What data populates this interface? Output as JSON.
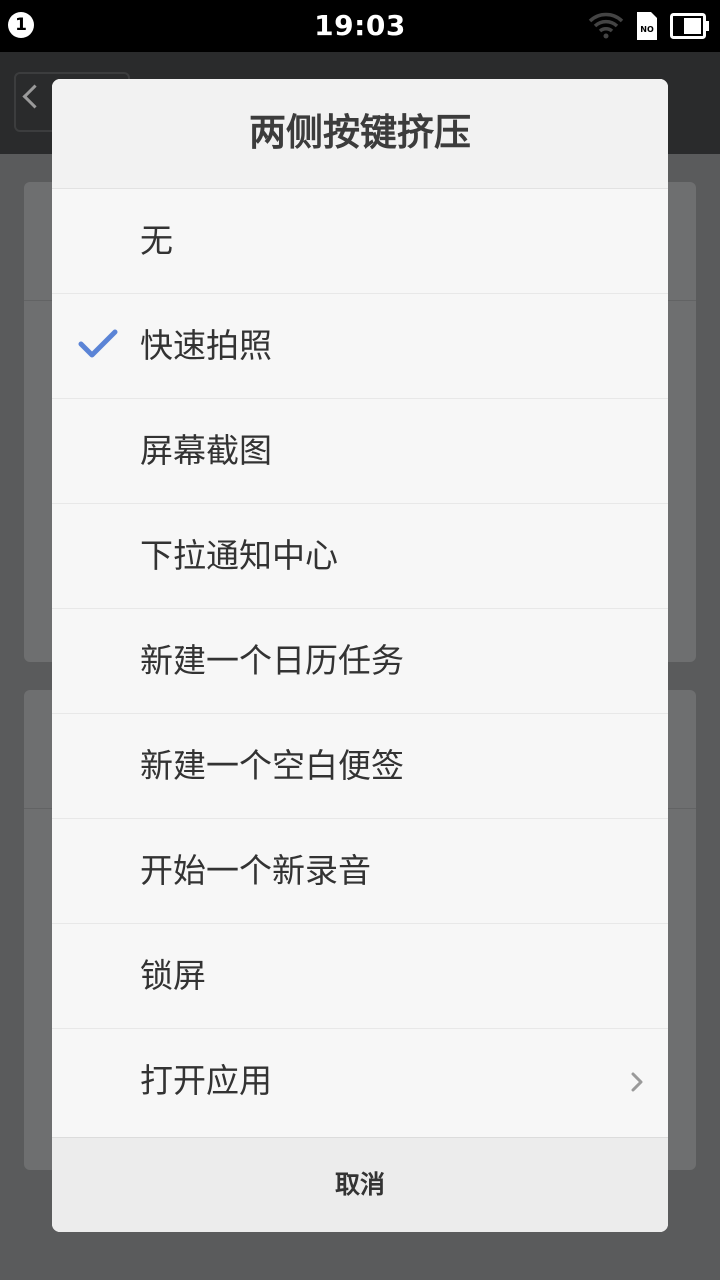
{
  "status_bar": {
    "notification_count": "1",
    "time": "19:03",
    "sim_label": "NO"
  },
  "dialog": {
    "title": "两侧按键挤压",
    "selected_index": 1,
    "options": [
      {
        "label": "无"
      },
      {
        "label": "快速拍照"
      },
      {
        "label": "屏幕截图"
      },
      {
        "label": "下拉通知中心"
      },
      {
        "label": "新建一个日历任务"
      },
      {
        "label": "新建一个空白便签"
      },
      {
        "label": "开始一个新录音"
      },
      {
        "label": "锁屏"
      },
      {
        "label": "打开应用"
      }
    ],
    "cancel_label": "取消"
  },
  "colors": {
    "accent_check": "#5b84d6",
    "status_bar_bg": "#000000",
    "dim_overlay": "#5a5b5c"
  }
}
